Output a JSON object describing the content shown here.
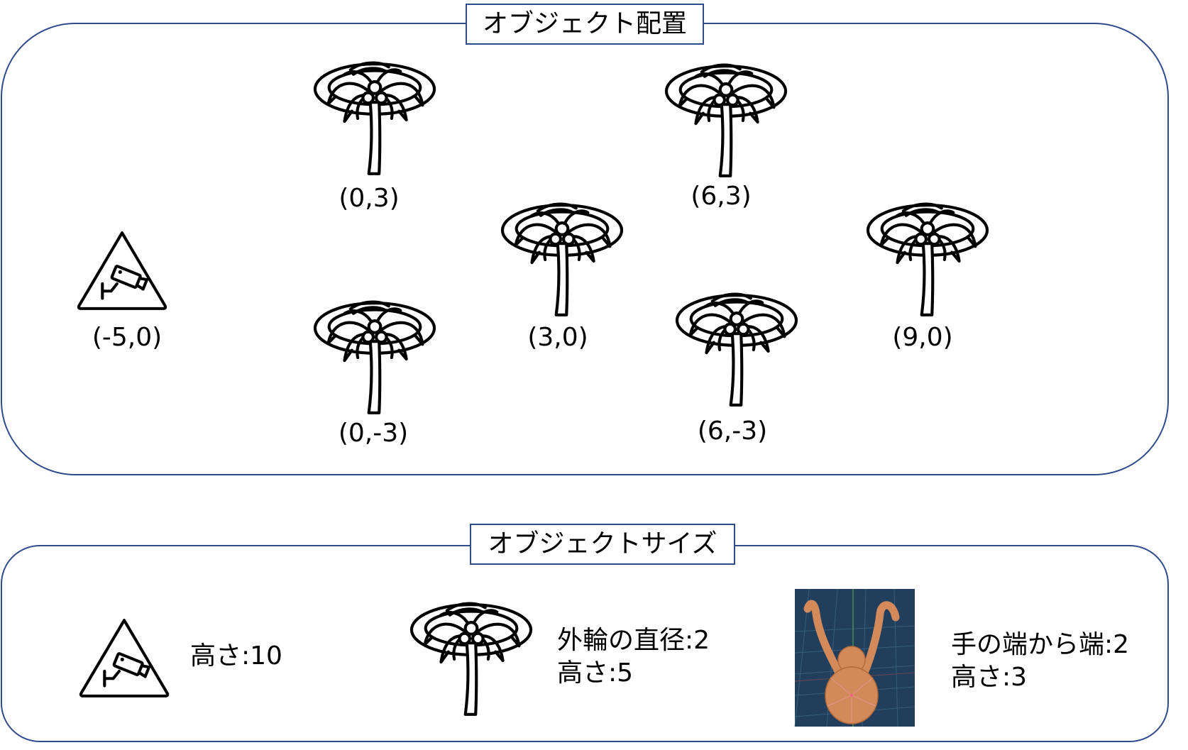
{
  "placement": {
    "title": "オブジェクト配置",
    "objects": [
      {
        "icon": "camera-warning-icon",
        "label": "(-5,0)"
      },
      {
        "icon": "palm-tree-icon",
        "label": "(0,3)"
      },
      {
        "icon": "palm-tree-icon",
        "label": "(6,3)"
      },
      {
        "icon": "palm-tree-icon",
        "label": "(3,0)"
      },
      {
        "icon": "palm-tree-icon",
        "label": "(9,0)"
      },
      {
        "icon": "palm-tree-icon",
        "label": "(0,-3)"
      },
      {
        "icon": "palm-tree-icon",
        "label": "(6,-3)"
      }
    ]
  },
  "sizes": {
    "title": "オブジェクトサイズ",
    "items": [
      {
        "icon": "camera-warning-icon",
        "lines": [
          "高さ:10"
        ]
      },
      {
        "icon": "palm-tree-icon",
        "lines": [
          "外輪の直径:2",
          "高さ:5"
        ]
      },
      {
        "icon": "model-preview-image",
        "lines": [
          "手の端から端:2",
          "高さ:3"
        ]
      }
    ]
  },
  "colors": {
    "frame": "#2F4B8C",
    "text": "#000000",
    "background": "#FFFFFF",
    "model": "#D4895A",
    "model_bg": "#213F5C"
  }
}
